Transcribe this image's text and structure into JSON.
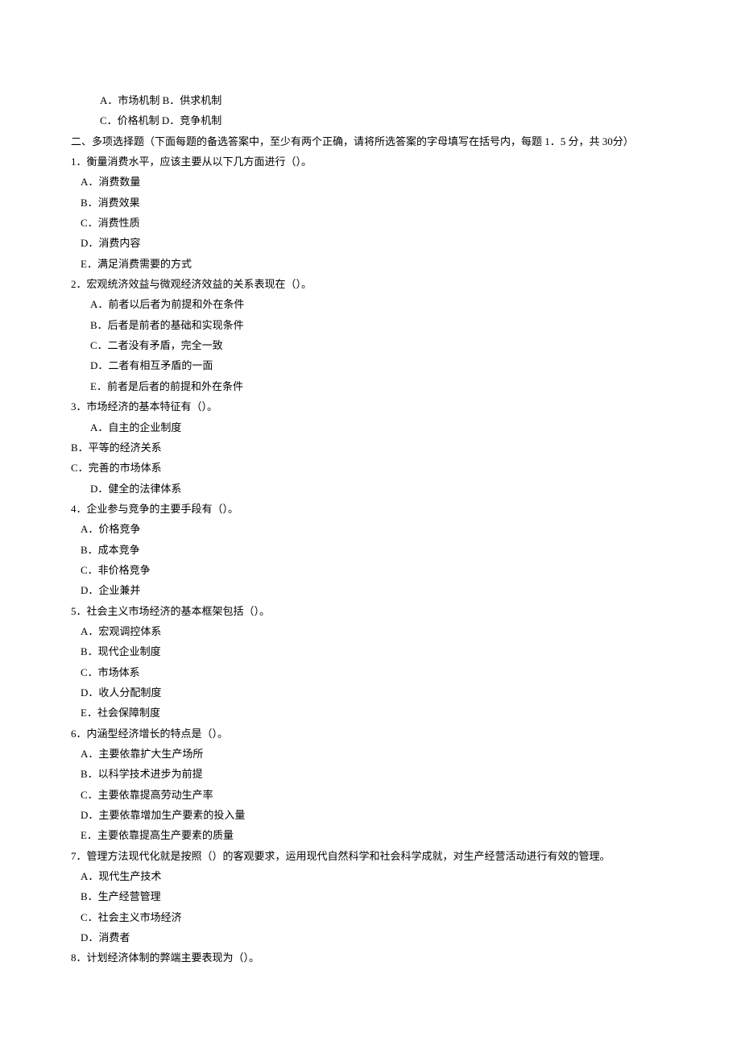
{
  "prev_question_tail": {
    "options": [
      "A．市场机制 B．供求机制",
      "C．价格机制 D．竞争机制"
    ]
  },
  "section2": {
    "heading": "二、多项选择题（下面每题的备选答案中，至少有两个正确，请将所选答案的字母填写在括号内，每题 1．5 分，共 30分）"
  },
  "q1": {
    "stem": "1．衡量消费水平，应该主要从以下几方面进行（）。",
    "opts": {
      "a": "A．消费数量",
      "b": "B．消费效果",
      "c": "C．消费性质",
      "d": "D．消费内容",
      "e": "E．满足消费需要的方式"
    }
  },
  "q2": {
    "stem": "2．宏观统济效益与微观经济效益的关系表现在（）。",
    "opts": {
      "a": "A．前者以后者为前提和外在条件",
      "b": "B．后者是前者的基础和实现条件",
      "c": "C．二者没有矛盾，完全一致",
      "d": "D．二者有相互矛盾的一面",
      "e": "E．前者是后者的前提和外在条件"
    }
  },
  "q3": {
    "stem": "3．市场经济的基本特征有（）。",
    "opts": {
      "a": "A．自主的企业制度",
      "b": "B．平等的经济关系",
      "c": "C．完善的市场体系",
      "d": "D．健全的法律体系"
    }
  },
  "q4": {
    "stem": "4．企业参与竞争的主要手段有（）。",
    "opts": {
      "a": "A．价格竞争",
      "b": "B．成本竞争",
      "c": "C．非价格竞争",
      "d": "D．企业兼并"
    }
  },
  "q5": {
    "stem": "5．社会主义市场经济的基本框架包括（）。",
    "opts": {
      "a": "A．宏观调控体系",
      "b": "B．现代企业制度",
      "c": "C．市场体系",
      "d": "D．收人分配制度",
      "e": "E．社会保障制度"
    }
  },
  "q6": {
    "stem": "6．内涵型经济增长的特点是（）。",
    "opts": {
      "a": "A．主要依靠扩大生产场所",
      "b": "B．以科学技术进步为前提",
      "c": "C．主要依靠提高劳动生产率",
      "d": "D．主要依靠增加生产要素的投入量",
      "e": "E．主要依靠提高生产要素的质量"
    }
  },
  "q7": {
    "stem": "7．管理方法现代化就是按照（）的客观要求，运用现代自然科学和社会科学成就，对生产经营活动进行有效的管理。",
    "opts": {
      "a": "A．现代生产技术",
      "b": "B．生产经营管理",
      "c": "C．社会主义市场经济",
      "d": "D．消费者"
    }
  },
  "q8": {
    "stem": "8．计划经济体制的弊端主要表现为（）。"
  }
}
